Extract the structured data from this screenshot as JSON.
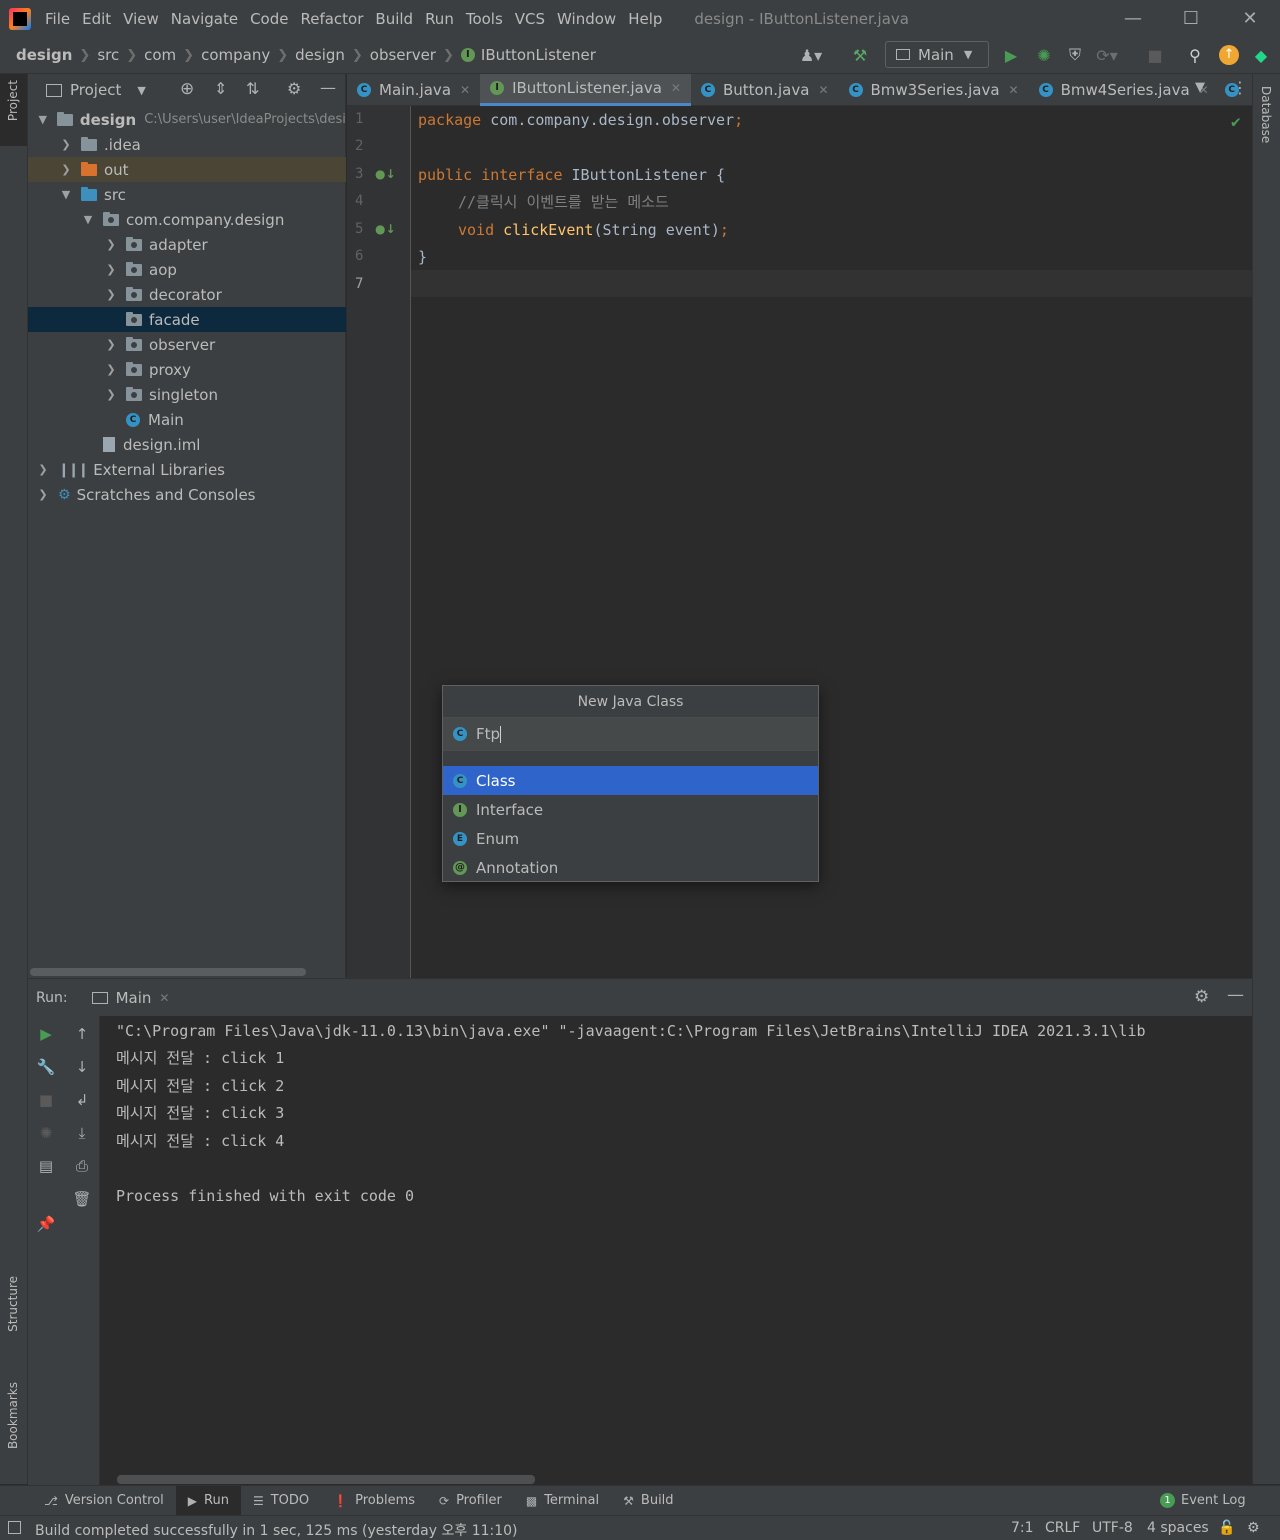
{
  "window": {
    "menu": [
      "File",
      "Edit",
      "View",
      "Navigate",
      "Code",
      "Refactor",
      "Build",
      "Run",
      "Tools",
      "VCS",
      "Window",
      "Help"
    ],
    "title": "design - IButtonListener.java"
  },
  "breadcrumb": [
    "design",
    "src",
    "com",
    "company",
    "design",
    "observer",
    "IButtonListener"
  ],
  "toolbar": {
    "run_config": "Main"
  },
  "project": {
    "header": "Project",
    "tree": [
      {
        "label": "design",
        "path": "C:\\Users\\user\\IdeaProjects\\design"
      },
      {
        "label": ".idea"
      },
      {
        "label": "out"
      },
      {
        "label": "src"
      },
      {
        "label": "com.company.design"
      },
      {
        "label": "adapter"
      },
      {
        "label": "aop"
      },
      {
        "label": "decorator"
      },
      {
        "label": "facade"
      },
      {
        "label": "observer"
      },
      {
        "label": "proxy"
      },
      {
        "label": "singleton"
      },
      {
        "label": "Main"
      },
      {
        "label": "design.iml"
      },
      {
        "label": "External Libraries"
      },
      {
        "label": "Scratches and Consoles"
      }
    ]
  },
  "tabs": [
    "Main.java",
    "IButtonListener.java",
    "Button.java",
    "Bmw3Series.java",
    "Bmw4Series.java"
  ],
  "editor": {
    "line_numbers": [
      "1",
      "2",
      "3",
      "4",
      "5",
      "6",
      "7"
    ],
    "lines": {
      "l1_kw": "package",
      "l1_rest": " com.company.design.observer",
      "l1_semi": ";",
      "l3_kw1": "public",
      "l3_kw2": "interface",
      "l3_rest": " IButtonListener {",
      "l4_comment": "//클릭시 이벤트를 받는 메소드",
      "l5_kw": "void",
      "l5_fn": "clickEvent",
      "l5_rest": "(String event)",
      "l5_semi": ";",
      "l6": "}"
    }
  },
  "dialog": {
    "title": "New Java Class",
    "input_value": "Ftp",
    "kinds": [
      "Class",
      "Interface",
      "Enum",
      "Annotation"
    ]
  },
  "run": {
    "label": "Run:",
    "tab": "Main",
    "console": [
      "\"C:\\Program Files\\Java\\jdk-11.0.13\\bin\\java.exe\" \"-javaagent:C:\\Program Files\\JetBrains\\IntelliJ IDEA 2021.3.1\\lib",
      "메시지 전달 : click 1",
      "메시지 전달 : click 2",
      "메시지 전달 : click 3",
      "메시지 전달 : click 4",
      "",
      "Process finished with exit code 0"
    ]
  },
  "side_labels": {
    "project": "Project",
    "structure": "Structure",
    "bookmarks": "Bookmarks",
    "database": "Database"
  },
  "tool_windows": [
    "Version Control",
    "Run",
    "TODO",
    "Problems",
    "Profiler",
    "Terminal",
    "Build"
  ],
  "event_log": {
    "count": "1",
    "label": "Event Log"
  },
  "status": {
    "message": "Build completed successfully in 1 sec, 125 ms (yesterday 오후 11:10)",
    "position": "7:1",
    "line_sep": "CRLF",
    "encoding": "UTF-8",
    "indent": "4 spaces"
  },
  "colors": {
    "accent": "#2f65ca",
    "keyword": "#cc7832",
    "function": "#ffc66d",
    "run_green": "#499c54"
  }
}
